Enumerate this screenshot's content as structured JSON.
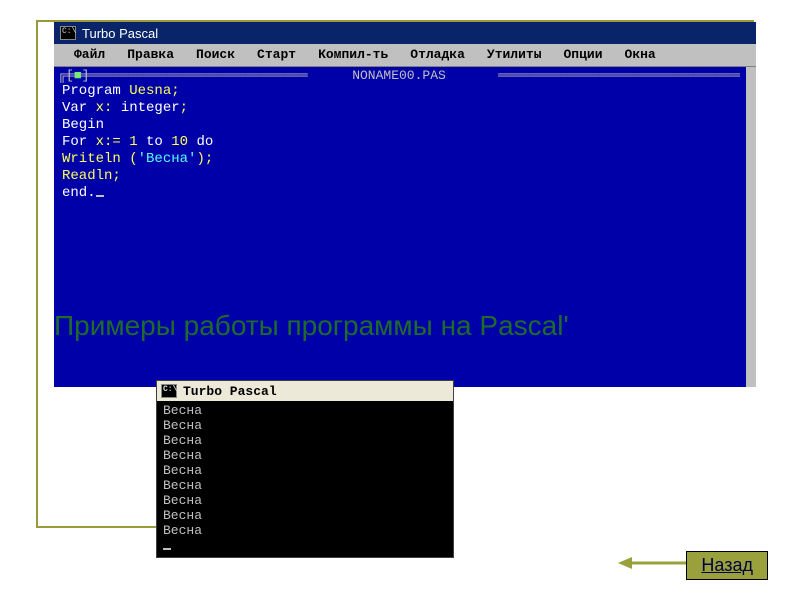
{
  "slide": {
    "heading": "Примеры работы программы на Pascal'",
    "back_label": "Назад"
  },
  "editor": {
    "title": "Turbo Pascal",
    "menu": [
      "Файл",
      "Правка",
      "Поиск",
      "Старт",
      "Компил-ть",
      "Отладка",
      "Утилиты",
      "Опции",
      "Окна"
    ],
    "docname": "NONAME00.PAS",
    "code": {
      "l1_kw": "Program ",
      "l1_id": "Uesna;",
      "l2_kw": "Var ",
      "l2_id": "x: ",
      "l2_kw2": "integer",
      "l2_end": ";",
      "l3": "Begin",
      "l4_kw1": "For ",
      "l4_id": "x:= ",
      "l4_n1": "1 ",
      "l4_kw2": "to ",
      "l4_n2": "10 ",
      "l4_kw3": "do",
      "l5a": "Writeln (",
      "l5s": "'Весна'",
      "l5b": ");",
      "l6": "Readln;",
      "l7": "end."
    }
  },
  "output": {
    "title": "Turbo Pascal",
    "lines": [
      "Весна",
      "Весна",
      "Весна",
      "Весна",
      "Весна",
      "Весна",
      "Весна",
      "Весна",
      "Весна"
    ]
  }
}
